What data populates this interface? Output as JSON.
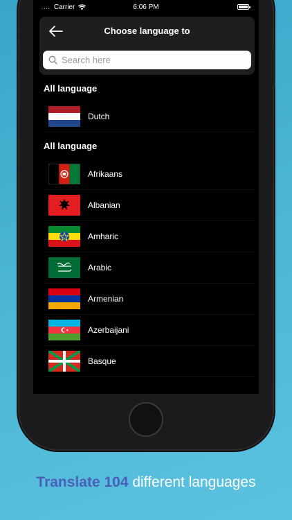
{
  "status_bar": {
    "dots": "....",
    "carrier": "Carrier",
    "time": "6:06 PM"
  },
  "header": {
    "title": "Choose language to",
    "search_placeholder": "Search here"
  },
  "sections": [
    {
      "title": "All language",
      "items": [
        {
          "label": "Dutch",
          "flag": "netherlands-flag"
        }
      ]
    },
    {
      "title": "All language",
      "items": [
        {
          "label": "Afrikaans",
          "flag": "afghanistan-flag"
        },
        {
          "label": "Albanian",
          "flag": "albania-flag"
        },
        {
          "label": "Amharic",
          "flag": "ethiopia-flag"
        },
        {
          "label": "Arabic",
          "flag": "saudi-arabia-flag"
        },
        {
          "label": "Armenian",
          "flag": "armenia-flag"
        },
        {
          "label": "Azerbaijani",
          "flag": "azerbaijan-flag"
        },
        {
          "label": "Basque",
          "flag": "basque-flag"
        }
      ]
    }
  ],
  "caption": {
    "accent": "Translate 104",
    "rest": " different languages"
  },
  "colors": {
    "accent": "#4c5fb8",
    "background": "#4bb4d4",
    "screen": "#000000"
  }
}
